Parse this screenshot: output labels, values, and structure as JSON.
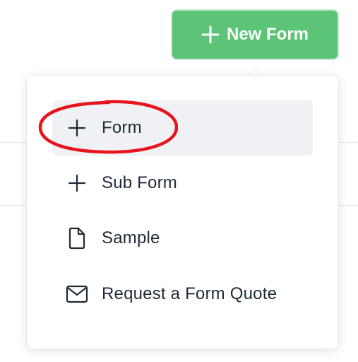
{
  "header": {
    "new_form_button": {
      "label": "New Form",
      "icon": "plus-icon"
    }
  },
  "dropdown": {
    "items": [
      {
        "label": "Form",
        "icon": "plus-icon",
        "active": true
      },
      {
        "label": "Sub Form",
        "icon": "plus-icon",
        "active": false
      },
      {
        "label": "Sample",
        "icon": "document-icon",
        "active": false
      },
      {
        "label": "Request a Form Quote",
        "icon": "mail-icon",
        "active": false
      }
    ]
  },
  "annotation": {
    "type": "ellipse-highlight",
    "target": "Form",
    "color": "#e8141c"
  },
  "colors": {
    "primary_button": "#5cc476",
    "active_item_bg": "#eff1f5",
    "text": "#1f2a37"
  }
}
